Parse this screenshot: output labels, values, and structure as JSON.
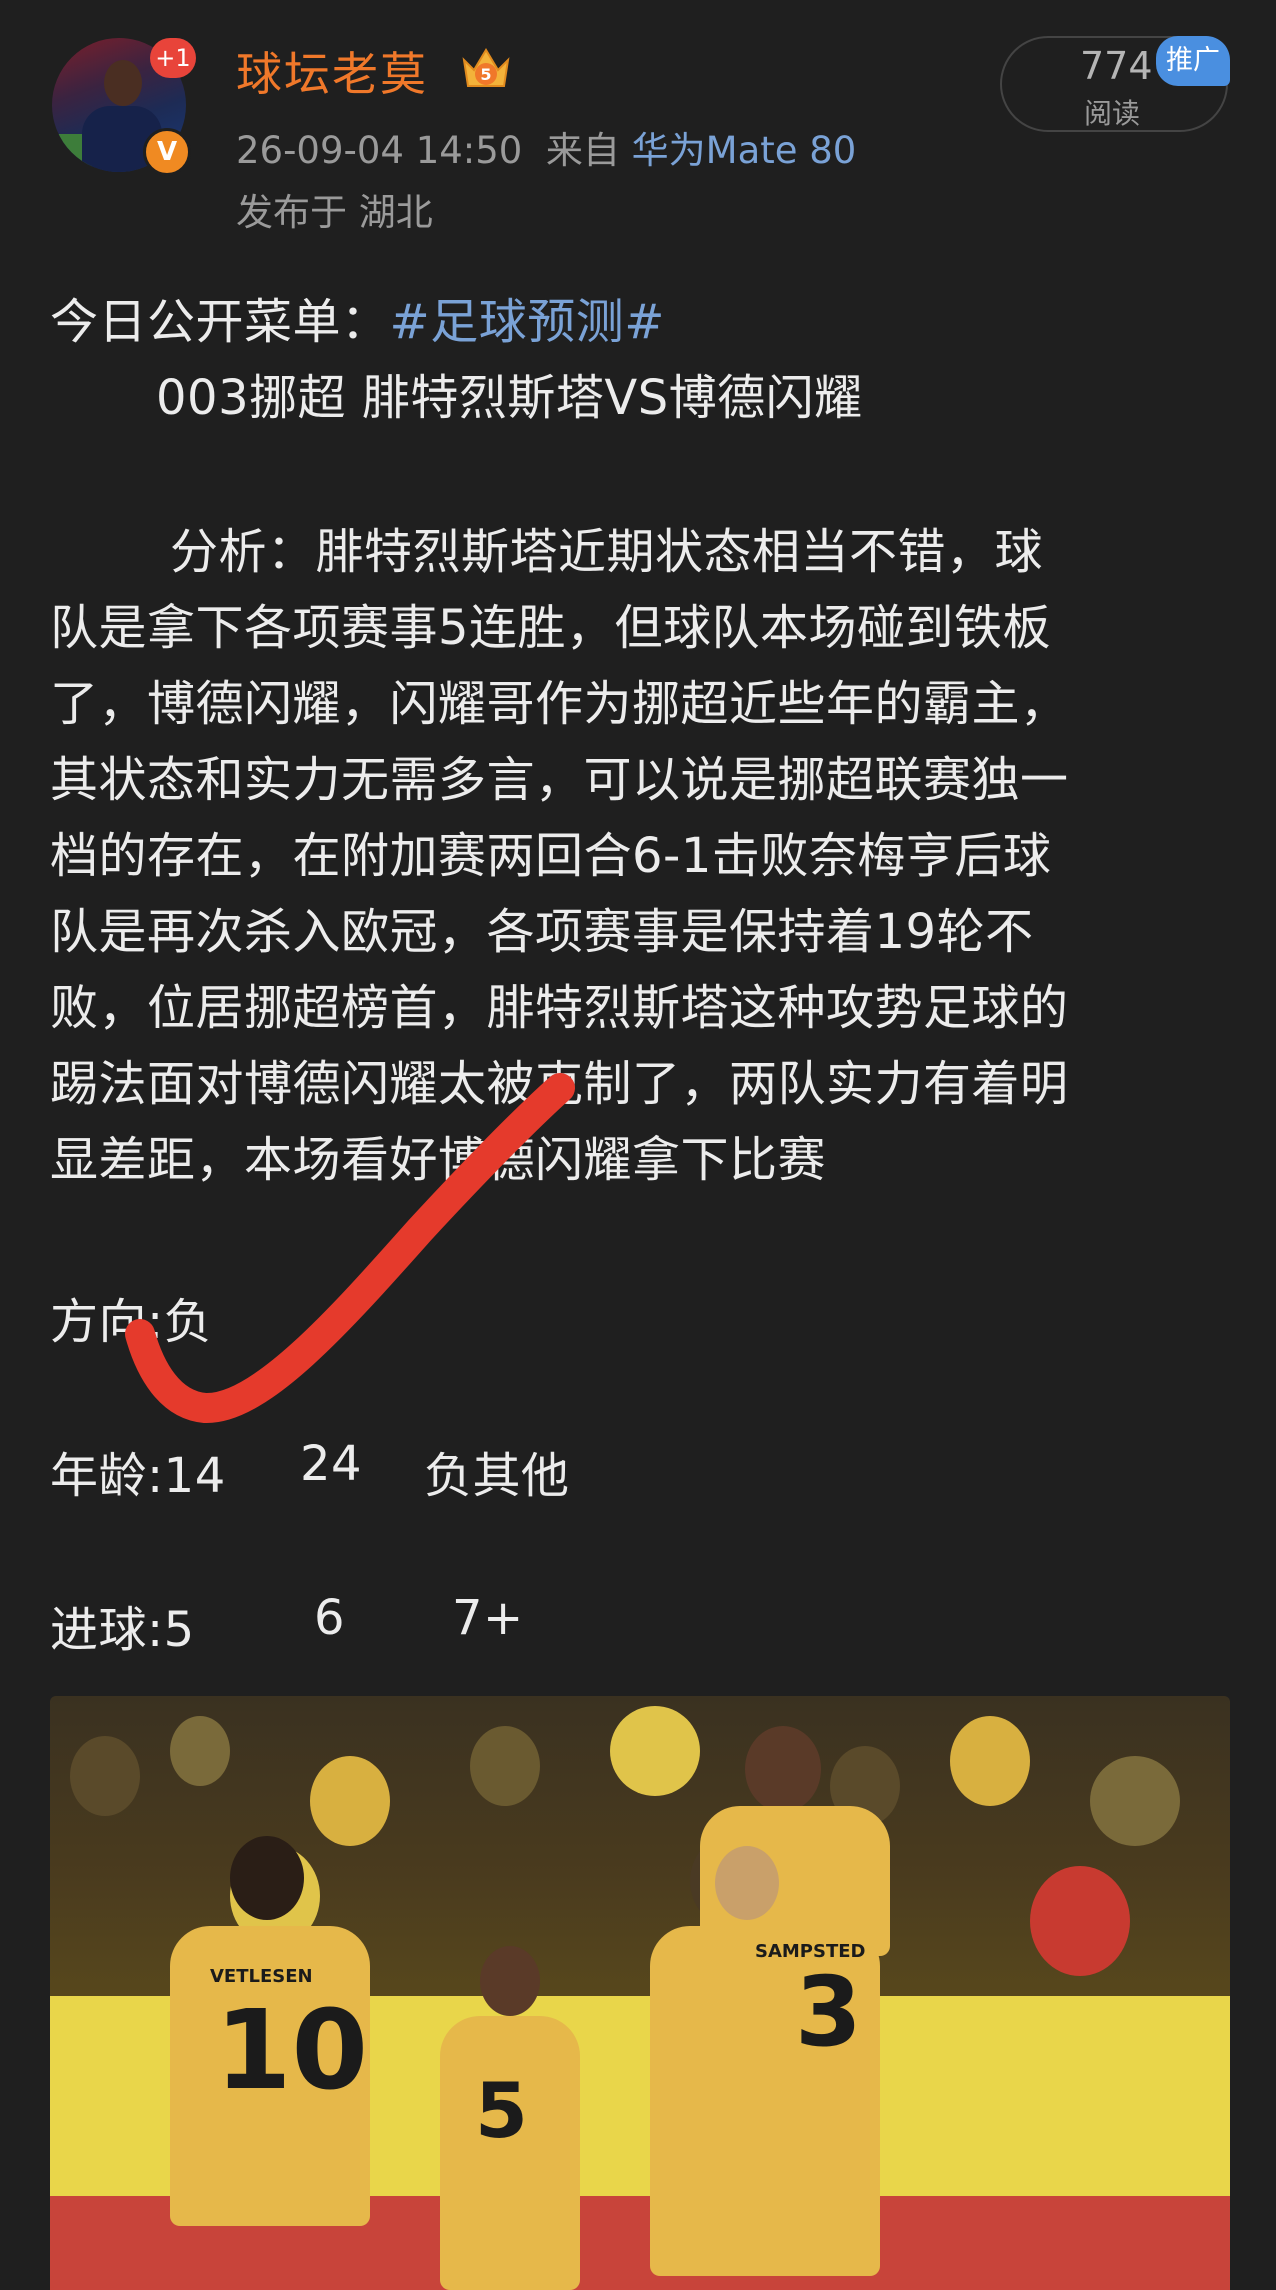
{
  "post": {
    "username": "球坛老莫",
    "level_badge": "5",
    "notify_badge": "+1",
    "verified_badge": "V",
    "timestamp": "26-09-04 14:50",
    "source_prefix": "来自",
    "device": "华为Mate 80",
    "location": "发布于 湖北",
    "read_count": "774",
    "read_label": "阅读",
    "promo_label": "推广"
  },
  "content": {
    "intro_prefix": "今日公开菜单：",
    "hashtag": "#足球预测#",
    "match_line": "003挪超 腓特烈斯塔VS博德闪耀",
    "analysis_lines": [
      "分析：腓特烈斯塔近期状态相当不错，球",
      "队是拿下各项赛事5连胜，但球队本场碰到铁板",
      "了，博德闪耀，闪耀哥作为挪超近些年的霸主，",
      "其状态和实力无需多言，可以说是挪超联赛独一",
      "档的存在，在附加赛两回合6-1击败奈梅亨后球",
      "队是再次杀入欧冠，各项赛事是保持着19轮不",
      "败，位居挪超榜首，腓特烈斯塔这种攻势足球的",
      "踢法面对博德闪耀太被克制了，两队实力有着明",
      "显差距，本场看好博德闪耀拿下比赛"
    ],
    "direction": "方向:负",
    "age_label": "年龄:14",
    "age_2": "24",
    "age_3": "负其他",
    "goals_label": "进球:5",
    "goals_2": "6",
    "goals_3": "7+"
  },
  "photo": {
    "jersey_names": [
      "VETLESEN",
      "SAMPSTED"
    ],
    "jersey_numbers": [
      "10",
      "3",
      "5"
    ],
    "colors": {
      "kit": "#e6b84a",
      "crowd": "#e9d64a",
      "checkmark": "#e53a2c"
    }
  },
  "icons": [
    "crown-level-icon",
    "verified-icon",
    "checkmark-annotation-icon"
  ]
}
